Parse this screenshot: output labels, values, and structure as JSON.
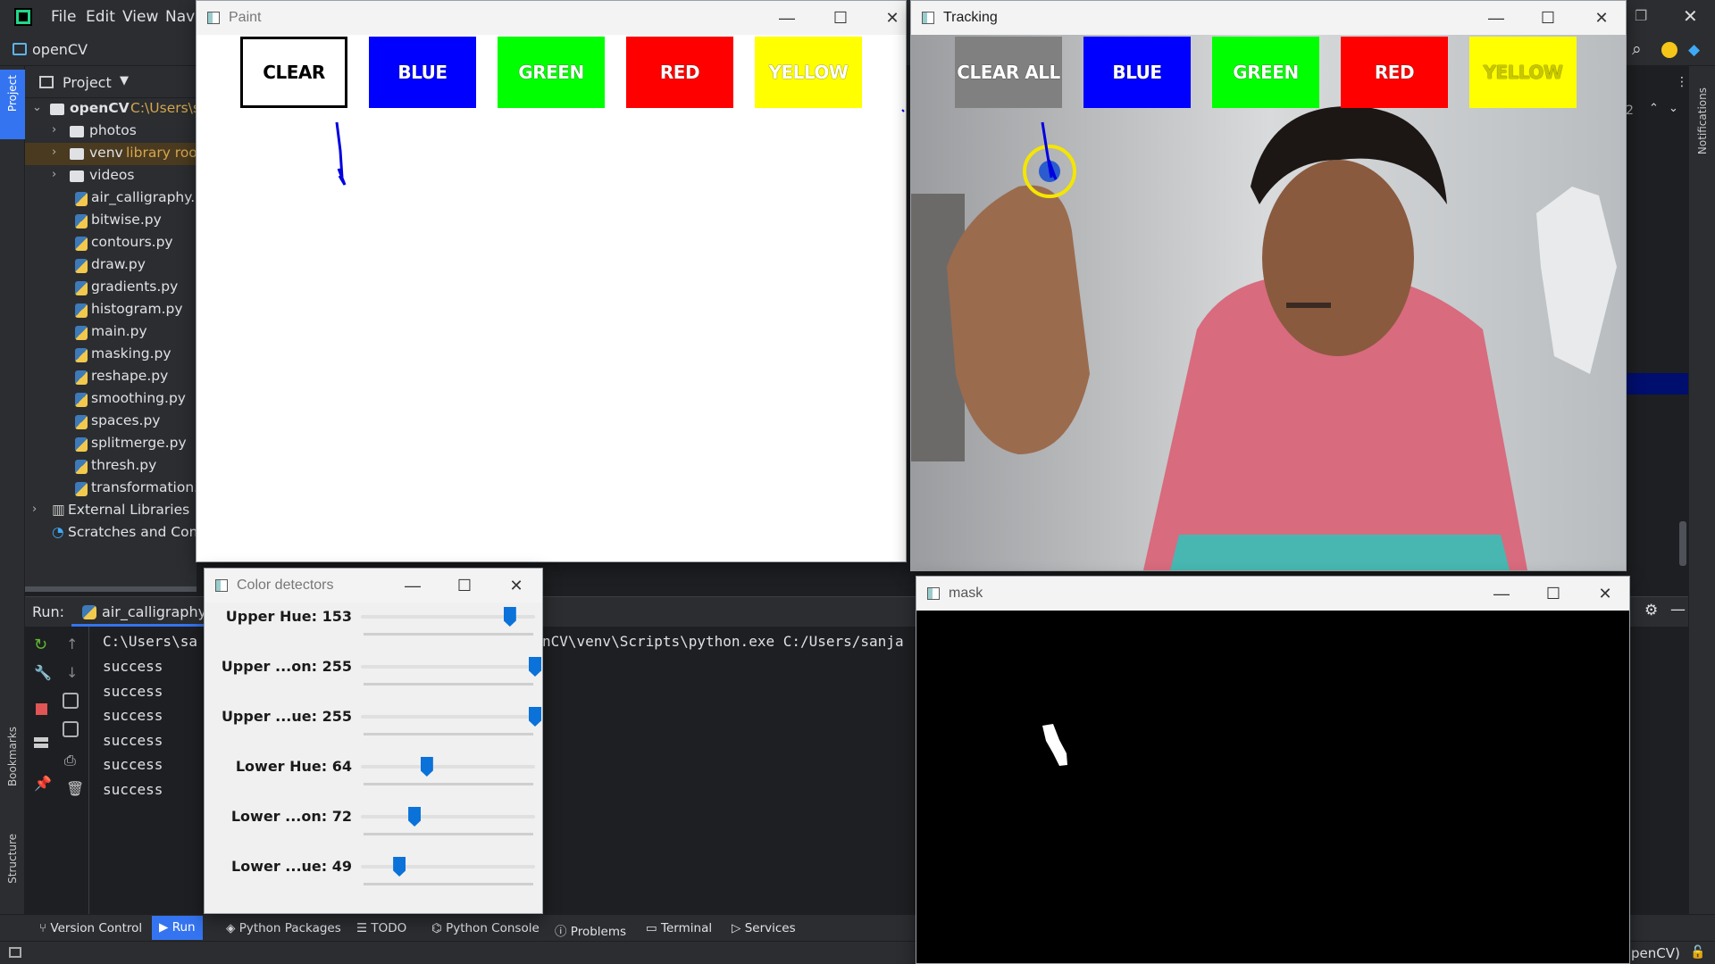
{
  "ide": {
    "menu": [
      "File",
      "Edit",
      "View",
      "Navi"
    ],
    "project_name": "openCV",
    "tool_window_title": "Project",
    "tree": [
      {
        "label": "openCV",
        "extra": "C:\\Users\\s",
        "type": "root"
      },
      {
        "label": "photos",
        "type": "folder"
      },
      {
        "label": "venv",
        "extra": "library roo",
        "type": "folder"
      },
      {
        "label": "videos",
        "type": "folder"
      },
      {
        "label": "air_calligraphy.p",
        "type": "py"
      },
      {
        "label": "bitwise.py",
        "type": "py"
      },
      {
        "label": "contours.py",
        "type": "py"
      },
      {
        "label": "draw.py",
        "type": "py"
      },
      {
        "label": "gradients.py",
        "type": "py"
      },
      {
        "label": "histogram.py",
        "type": "py"
      },
      {
        "label": "main.py",
        "type": "py"
      },
      {
        "label": "masking.py",
        "type": "py"
      },
      {
        "label": "reshape.py",
        "type": "py"
      },
      {
        "label": "smoothing.py",
        "type": "py"
      },
      {
        "label": "spaces.py",
        "type": "py"
      },
      {
        "label": "splitmerge.py",
        "type": "py"
      },
      {
        "label": "thresh.py",
        "type": "py"
      },
      {
        "label": "transformation.p",
        "type": "py"
      },
      {
        "label": "External Libraries",
        "type": "lib"
      },
      {
        "label": "Scratches and Cons",
        "type": "scratch"
      }
    ],
    "left_stripe": {
      "project": "Project",
      "bookmarks": "Bookmarks",
      "structure": "Structure"
    },
    "right_stripe": {
      "notifications": "Notifications",
      "count": "2"
    },
    "run": {
      "label": "Run:",
      "tab": "air_calligraphy",
      "command_left": "C:\\Users\\sa",
      "command_right": "nCV\\venv\\Scripts\\python.exe C:/Users/sanja",
      "output": [
        "success",
        "success",
        "success",
        "success",
        "success",
        "success"
      ]
    },
    "bottom_tabs": [
      "Version Control",
      "Run",
      "Python Packages",
      "TODO",
      "Python Console",
      "Problems",
      "Terminal",
      "Services"
    ],
    "status_right": "penCV)"
  },
  "paint_window": {
    "title": "Paint",
    "buttons": [
      {
        "label": "CLEAR",
        "color": "#ffffff",
        "text": "#000000"
      },
      {
        "label": "BLUE",
        "color": "#0000ff",
        "text": "#ffffff"
      },
      {
        "label": "GREEN",
        "color": "#00ff00",
        "text": "#ffffff"
      },
      {
        "label": "RED",
        "color": "#ff0000",
        "text": "#ffffff"
      },
      {
        "label": "YELLOW",
        "color": "#ffff00",
        "text": "#ffffff"
      }
    ]
  },
  "tracking_window": {
    "title": "Tracking",
    "buttons": [
      {
        "label": "CLEAR ALL",
        "color": "#808080",
        "text": "#ffffff"
      },
      {
        "label": "BLUE",
        "color": "#0000ff",
        "text": "#ffffff"
      },
      {
        "label": "GREEN",
        "color": "#00ff00",
        "text": "#ffffff"
      },
      {
        "label": "RED",
        "color": "#ff0000",
        "text": "#ffffff"
      },
      {
        "label": "YELLOW",
        "color": "#ffff00",
        "text": "#c8c800"
      }
    ]
  },
  "color_detectors_window": {
    "title": "Color detectors",
    "sliders": [
      {
        "label": "Upper Hue: 153",
        "value": 153,
        "max": 180
      },
      {
        "label": "Upper ...on: 255",
        "value": 255,
        "max": 255
      },
      {
        "label": "Upper ...ue: 255",
        "value": 255,
        "max": 255
      },
      {
        "label": "Lower Hue: 64",
        "value": 64,
        "max": 180
      },
      {
        "label": "Lower ...on: 72",
        "value": 72,
        "max": 255
      },
      {
        "label": "Lower ...ue: 49",
        "value": 49,
        "max": 255
      }
    ]
  },
  "mask_window": {
    "title": "mask"
  }
}
